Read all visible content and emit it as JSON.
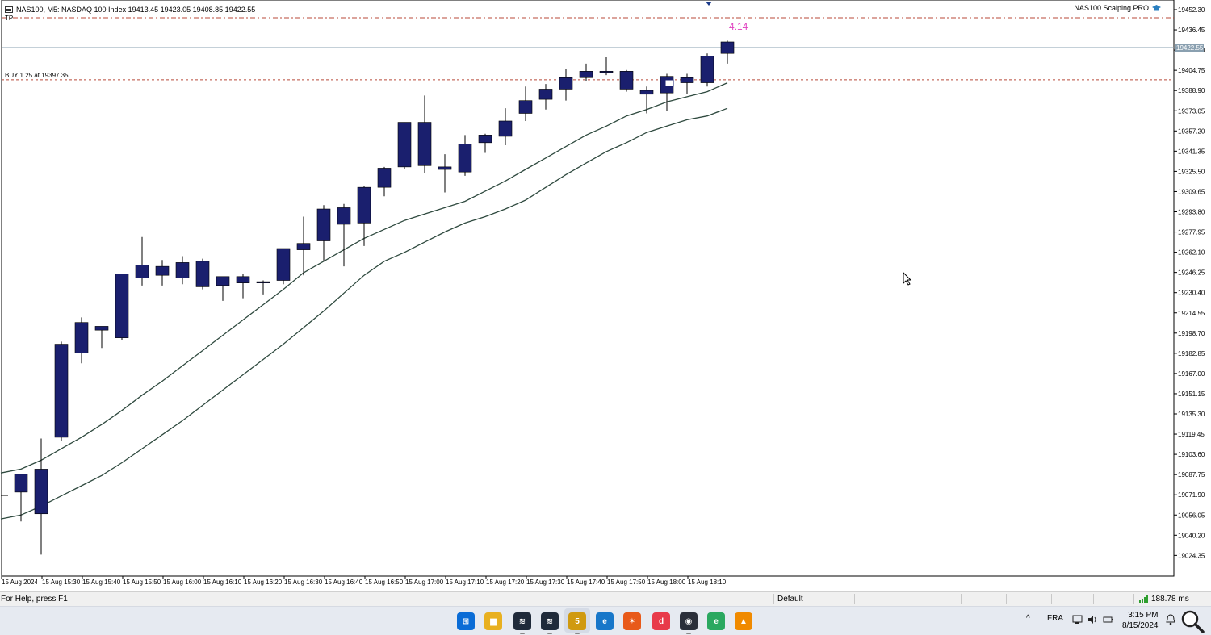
{
  "chart_header": {
    "symbol_info": "NAS100, M5:  NASDAQ 100 Index  19413.45  19423.05  19408.85  19422.55",
    "tp_label": "TP",
    "ea_name": "NAS100 Scalping PRO",
    "buy_label": "BUY 1.25 at 19397.35",
    "profit_label": "4.14",
    "current_price": "19422.55"
  },
  "price_axis": {
    "ticks": [
      "19452.30",
      "19436.45",
      "19420.60",
      "19404.75",
      "19388.90",
      "19373.05",
      "19357.20",
      "19341.35",
      "19325.50",
      "19309.65",
      "19293.80",
      "19277.95",
      "19262.10",
      "19246.25",
      "19230.40",
      "19214.55",
      "19198.70",
      "19182.85",
      "19167.00",
      "19151.15",
      "19135.30",
      "19119.45",
      "19103.60",
      "19087.75",
      "19071.90",
      "19056.05",
      "19040.20",
      "19024.35"
    ]
  },
  "time_axis": {
    "ticks": [
      "15 Aug 2024",
      "15 Aug 15:30",
      "15 Aug 15:40",
      "15 Aug 15:50",
      "15 Aug 16:00",
      "15 Aug 16:10",
      "15 Aug 16:20",
      "15 Aug 16:30",
      "15 Aug 16:40",
      "15 Aug 16:50",
      "15 Aug 17:00",
      "15 Aug 17:10",
      "15 Aug 17:20",
      "15 Aug 17:30",
      "15 Aug 17:40",
      "15 Aug 17:50",
      "15 Aug 18:00",
      "15 Aug 18:10"
    ]
  },
  "chart_data": {
    "type": "candlestick",
    "symbol": "NAS100",
    "timeframe": "M5",
    "ylim": [
      19018,
      19466
    ],
    "colors": {
      "candle": "#1a1f6e",
      "ma": "#2f4a3f",
      "tp_line": "#b84a3a",
      "buy_line": "#b84a3a",
      "price_line": "#8aa0b0"
    },
    "levels": {
      "tp": 19446.0,
      "buy": 19397.35,
      "current": 19422.55
    },
    "candles": [
      {
        "o": 19074,
        "h": 19088,
        "l": 19051,
        "c": 19088
      },
      {
        "o": 19092,
        "h": 19116,
        "l": 19025,
        "c": 19057
      },
      {
        "o": 19190,
        "h": 19192,
        "l": 19114,
        "c": 19117
      },
      {
        "o": 19207,
        "h": 19211,
        "l": 19175,
        "c": 19183
      },
      {
        "o": 19201,
        "h": 19201,
        "l": 19187,
        "c": 19204
      },
      {
        "o": 19245,
        "h": 19245,
        "l": 19193,
        "c": 19195
      },
      {
        "o": 19252,
        "h": 19274,
        "l": 19236,
        "c": 19242
      },
      {
        "o": 19251,
        "h": 19256,
        "l": 19236,
        "c": 19244
      },
      {
        "o": 19254,
        "h": 19259,
        "l": 19237,
        "c": 19242
      },
      {
        "o": 19255,
        "h": 19257,
        "l": 19233,
        "c": 19235
      },
      {
        "o": 19243,
        "h": 19243,
        "l": 19224,
        "c": 19236
      },
      {
        "o": 19243,
        "h": 19245,
        "l": 19226,
        "c": 19238
      },
      {
        "o": 19238,
        "h": 19240,
        "l": 19229,
        "c": 19239
      },
      {
        "o": 19265,
        "h": 19265,
        "l": 19237,
        "c": 19240
      },
      {
        "o": 19269,
        "h": 19290,
        "l": 19244,
        "c": 19264
      },
      {
        "o": 19296,
        "h": 19299,
        "l": 19255,
        "c": 19271
      },
      {
        "o": 19297,
        "h": 19300,
        "l": 19251,
        "c": 19284
      },
      {
        "o": 19313,
        "h": 19314,
        "l": 19267,
        "c": 19285
      },
      {
        "o": 19328,
        "h": 19329,
        "l": 19306,
        "c": 19313
      },
      {
        "o": 19364,
        "h": 19364,
        "l": 19327,
        "c": 19329
      },
      {
        "o": 19364,
        "h": 19385,
        "l": 19324,
        "c": 19330
      },
      {
        "o": 19329,
        "h": 19339,
        "l": 19309,
        "c": 19327
      },
      {
        "o": 19347,
        "h": 19354,
        "l": 19322,
        "c": 19325
      },
      {
        "o": 19354,
        "h": 19355,
        "l": 19340,
        "c": 19348
      },
      {
        "o": 19365,
        "h": 19375,
        "l": 19346,
        "c": 19353
      },
      {
        "o": 19381,
        "h": 19392,
        "l": 19365,
        "c": 19371
      },
      {
        "o": 19390,
        "h": 19394,
        "l": 19374,
        "c": 19382
      },
      {
        "o": 19399,
        "h": 19406,
        "l": 19381,
        "c": 19390
      },
      {
        "o": 19404,
        "h": 19410,
        "l": 19396,
        "c": 19399
      },
      {
        "o": 19404,
        "h": 19415,
        "l": 19401,
        "c": 19404
      },
      {
        "o": 19404,
        "h": 19405,
        "l": 19388,
        "c": 19390
      },
      {
        "o": 19389,
        "h": 19392,
        "l": 19371,
        "c": 19386
      },
      {
        "o": 19400,
        "h": 19402,
        "l": 19373,
        "c": 19387
      },
      {
        "o": 19399,
        "h": 19402,
        "l": 19386,
        "c": 19395
      },
      {
        "o": 19416,
        "h": 19418,
        "l": 19392,
        "c": 19395
      },
      {
        "o": 19427,
        "h": 19428,
        "l": 19410,
        "c": 19418
      }
    ],
    "ma_fast": [
      19089,
      19092,
      19099,
      19108,
      19117,
      19127,
      19138,
      19150,
      19161,
      19173,
      19185,
      19197,
      19209,
      19221,
      19233,
      19246,
      19255,
      19264,
      19273,
      19280,
      19287,
      19292,
      19297,
      19302,
      19310,
      19318,
      19327,
      19336,
      19345,
      19354,
      19361,
      19369,
      19374,
      19380,
      19384,
      19388,
      19395
    ],
    "ma_slow": [
      19053,
      19056,
      19063,
      19071,
      19079,
      19087,
      19097,
      19108,
      19119,
      19130,
      19142,
      19154,
      19166,
      19178,
      19190,
      19203,
      19216,
      19230,
      19244,
      19255,
      19262,
      19270,
      19278,
      19285,
      19290,
      19296,
      19303,
      19313,
      19323,
      19332,
      19341,
      19348,
      19356,
      19361,
      19366,
      19369,
      19375
    ]
  },
  "statusbar": {
    "help_text": "For Help, press F1",
    "profile": "Default",
    "ping": "188.78 ms"
  },
  "taskbar": {
    "apps": [
      {
        "name": "start-button",
        "glyph": "⊞",
        "color": "#0a6cd6"
      },
      {
        "name": "file-explorer-icon",
        "glyph": "▆",
        "color": "#e8b020"
      },
      {
        "name": "metatrader-icon-1",
        "glyph": "≋",
        "color": "#1f2a3a"
      },
      {
        "name": "metatrader-icon-2",
        "glyph": "≋",
        "color": "#1f2a3a"
      },
      {
        "name": "metatrader5-icon",
        "glyph": "5",
        "color": "#d09a10"
      },
      {
        "name": "edge-icon",
        "glyph": "e",
        "color": "#1877c9"
      },
      {
        "name": "app-orange-icon",
        "glyph": "✶",
        "color": "#e85a1a"
      },
      {
        "name": "app-red-icon",
        "glyph": "d",
        "color": "#e83a4a"
      },
      {
        "name": "app-dark-icon",
        "glyph": "◉",
        "color": "#2a2f3a"
      },
      {
        "name": "edge-dev-icon",
        "glyph": "e",
        "color": "#2aa860"
      },
      {
        "name": "vlc-icon",
        "glyph": "▲",
        "color": "#f08a00"
      }
    ],
    "language": "FRA",
    "time": "3:15 PM",
    "date": "8/15/2024",
    "tray_up": "^"
  }
}
